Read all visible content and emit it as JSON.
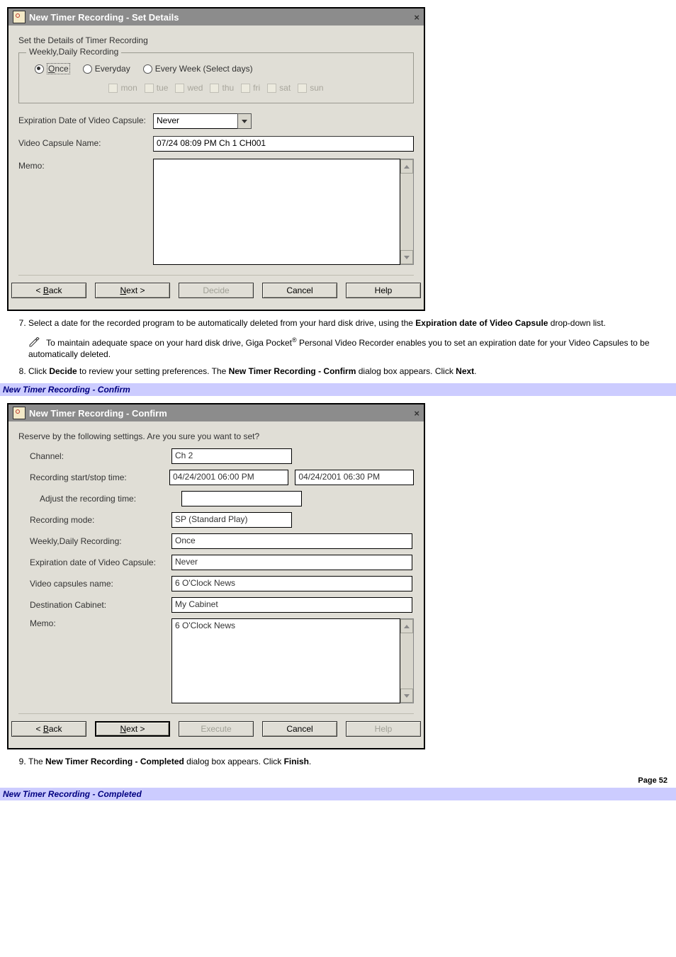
{
  "dialog1": {
    "title": "New Timer Recording - Set Details",
    "sectionLabel": "Set the Details of Timer Recording",
    "group": {
      "legend": "Weekly,Daily Recording",
      "radios": {
        "once": "Once",
        "everyday": "Everyday",
        "everyweek": "Every Week (Select days)"
      },
      "days": {
        "mon": "mon",
        "tue": "tue",
        "wed": "wed",
        "thu": "thu",
        "fri": "fri",
        "sat": "sat",
        "sun": "sun"
      }
    },
    "rows": {
      "expirationLabel": "Expiration Date of Video Capsule:",
      "expirationValue": "Never",
      "capsuleNameLabel": "Video Capsule Name:",
      "capsuleNameValue": "07/24 08:09 PM Ch 1 CH001",
      "memoLabel": "Memo:"
    },
    "buttons": {
      "back": "< Back",
      "next": "Next >",
      "decide": "Decide",
      "cancel": "Cancel",
      "help": "Help"
    }
  },
  "text": {
    "step7": "Select a date for the recorded program to be automatically deleted from your hard disk drive, using the ",
    "step7bold": "Expiration date of Video Capsule",
    "step7cont": " drop-down list.",
    "note1a": " To maintain adequate space on your hard disk drive, Giga Pocket",
    "note1b": " Personal Video Recorder enables you to set an expiration date for your Video Capsules to be automatically deleted.",
    "step8a": "Click ",
    "step8b": "Decide",
    "step8c": " to review your setting preferences. The ",
    "step8d": "New Timer Recording - Confirm",
    "step8e": " dialog box appears. Click ",
    "step8f": "Next",
    "step8g": ".",
    "caption2": "New Timer Recording - Confirm",
    "step9a": "The ",
    "step9b": "New Timer Recording - Completed",
    "step9c": " dialog box appears. Click ",
    "step9d": "Finish",
    "step9e": ".",
    "page": "Page 52",
    "caption3": "New Timer Recording - Completed",
    "reg": "®"
  },
  "dialog2": {
    "title": "New Timer Recording - Confirm",
    "topText": "Reserve by the following settings. Are you sure you want to set?",
    "labels": {
      "channel": "Channel:",
      "time": "Recording start/stop time:",
      "adjust": "Adjust the recording time:",
      "mode": "Recording mode:",
      "weekly": "Weekly,Daily Recording:",
      "expiration": "Expiration date of Video Capsule:",
      "capsName": "Video capsules name:",
      "dest": "Destination Cabinet:",
      "memo": "Memo:"
    },
    "values": {
      "channel": "Ch 2",
      "start": "04/24/2001 06:00 PM",
      "stop": "04/24/2001 06:30 PM",
      "adjust": "",
      "mode": "SP (Standard Play)",
      "weekly": "Once",
      "expiration": "Never",
      "capsName": "6 O'Clock News",
      "dest": "My Cabinet",
      "memo": "6 O'Clock News"
    },
    "buttons": {
      "back": "< Back",
      "next": "Next >",
      "execute": "Execute",
      "cancel": "Cancel",
      "help": "Help"
    }
  }
}
